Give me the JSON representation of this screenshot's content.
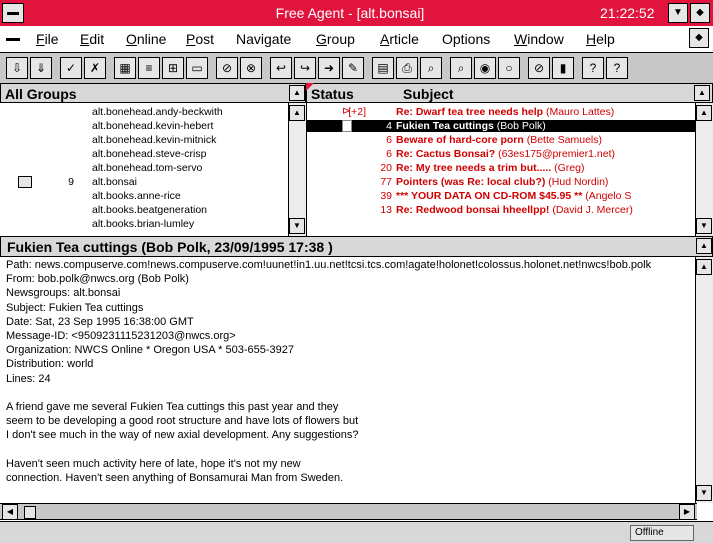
{
  "window": {
    "title": "Free Agent - [alt.bonsai]",
    "clock": "21:22:52",
    "titlebar_color": "#e0143c"
  },
  "menu": [
    {
      "label": "File",
      "ul": "F",
      "rest": "ile"
    },
    {
      "label": "Edit",
      "ul": "E",
      "rest": "dit"
    },
    {
      "label": "Online",
      "ul": "O",
      "rest": "nline"
    },
    {
      "label": "Post",
      "ul": "P",
      "rest": "ost"
    },
    {
      "label": "Navigate",
      "ul": "",
      "rest": "Navigate"
    },
    {
      "label": "Group",
      "ul": "G",
      "rest": "roup"
    },
    {
      "label": "Article",
      "ul": "A",
      "rest": "rticle"
    },
    {
      "label": "Options",
      "ul": "",
      "rest": "Options"
    },
    {
      "label": "Window",
      "ul": "W",
      "rest": "indow"
    },
    {
      "label": "Help",
      "ul": "H",
      "rest": "elp"
    }
  ],
  "toolbar_icons": [
    "get-headers-icon",
    "get-bodies-icon",
    "mark-icon",
    "unmark-icon",
    "groups-icon",
    "threads-icon",
    "subscribe-icon",
    "folder-icon",
    "delete-icon",
    "cancel-icon",
    "reply-icon",
    "followup-icon",
    "forward-icon",
    "compose-icon",
    "save-icon",
    "print-icon",
    "find-icon",
    "find-next-icon",
    "online-icon",
    "offline-icon",
    "stop-icon",
    "book-icon",
    "help-icon",
    "help-topics-icon"
  ],
  "groups_pane": {
    "header": "All Groups",
    "groups": [
      {
        "count": "",
        "name": "alt.bonehead.andy-beckwith"
      },
      {
        "count": "",
        "name": "alt.bonehead.kevin-hebert"
      },
      {
        "count": "",
        "name": "alt.bonehead.kevin-mitnick"
      },
      {
        "count": "",
        "name": "alt.bonehead.steve-crisp"
      },
      {
        "count": "",
        "name": "alt.bonehead.tom-servo"
      },
      {
        "count": "9",
        "name": "alt.bonsai"
      },
      {
        "count": "",
        "name": "alt.books.anne-rice"
      },
      {
        "count": "",
        "name": "alt.books.beatgeneration"
      },
      {
        "count": "",
        "name": "alt.books.brian-lumley"
      }
    ]
  },
  "articles_pane": {
    "status_header": "Status",
    "subject_header": "Subject",
    "articles": [
      {
        "count": "[+2]",
        "subject": "Re: Dwarf tea tree needs help",
        "author": "(Mauro Lattes)"
      },
      {
        "count": "4",
        "subject": "Fukien Tea cuttings",
        "author": "(Bob Polk)"
      },
      {
        "count": "6",
        "subject": "Beware of hard-core porn",
        "author": "(Bette Samuels)"
      },
      {
        "count": "6",
        "subject": "Re: Cactus Bonsai?",
        "author": "(63es175@premier1.net)"
      },
      {
        "count": "20",
        "subject": "Re: My tree needs a trim but.....",
        "author": "(Greg)"
      },
      {
        "count": "77",
        "subject": "Pointers (was Re: local club?)",
        "author": "(Hud Nordin)"
      },
      {
        "count": "39",
        "subject": "*** YOUR DATA ON CD-ROM $45.95 **",
        "author": "(Angelo S"
      },
      {
        "count": "13",
        "subject": "Re: Redwood bonsai hheellpp!",
        "author": "(David J. Mercer)"
      }
    ]
  },
  "article": {
    "title": "Fukien Tea cuttings (Bob Polk, 23/09/1995 17:38 )",
    "lines": [
      "Path: news.compuserve.com!news.compuserve.com!uunet!in1.uu.net!tcsi.tcs.com!agate!holonet!colossus.holonet.net!nwcs!bob.polk",
      "From: bob.polk@nwcs.org (Bob Polk)",
      "Newsgroups: alt.bonsai",
      "Subject: Fukien Tea cuttings",
      "Date: Sat, 23 Sep 1995 16:38:00 GMT",
      "Message-ID: <9509231115231203@nwcs.org>",
      "Organization: NWCS Online * Oregon USA * 503-655-3927",
      "Distribution: world",
      "Lines: 24",
      "",
      "A friend gave me several Fukien Tea cuttings this past year and they",
      "seem to be developing a good root structure and have lots of flowers but",
      "I don't see much in the way of new axial development. Any suggestions?",
      "",
      "Haven't seen much activity here of late, hope it's not my new",
      "connection. Haven't seen anything of Bonsamurai Man from Sweden."
    ]
  },
  "status": {
    "mode": "Offline"
  }
}
